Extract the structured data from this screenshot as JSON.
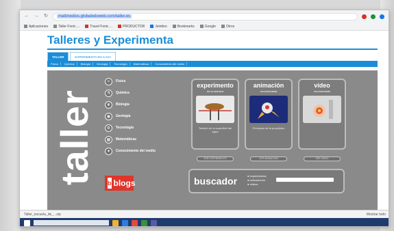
{
  "browser": {
    "url": "mattmedios.globaleduweb.com/taller.es",
    "bookmarks": [
      "Aplicaciones",
      "Taller Fonic ...",
      "Travel Fonic ...",
      "PRODUCTOR",
      "Jointtoo",
      "Bookmarks",
      "Google",
      "Otros"
    ]
  },
  "site": {
    "title": "Talleres y Experimenta",
    "tabs": [
      {
        "label": "TALLER"
      },
      {
        "label": "EXPERIMENTA EN CASA"
      }
    ],
    "subnav": [
      "Física",
      "Química",
      "Biología",
      "Geología",
      "Tecnología",
      "Matemáticas",
      "Conocimiento del medio"
    ]
  },
  "taller": {
    "heading": "taller",
    "sidebar": [
      {
        "label": "Física",
        "icon": "atom-icon"
      },
      {
        "label": "Química",
        "icon": "flask-icon"
      },
      {
        "label": "Biología",
        "icon": "leaf-icon"
      },
      {
        "label": "Geología",
        "icon": "globe-icon"
      },
      {
        "label": "Tecnología",
        "icon": "gear-icon"
      },
      {
        "label": "Matemáticas",
        "icon": "calculator-icon"
      },
      {
        "label": "Conocimiento del medio",
        "icon": "compass-icon"
      }
    ],
    "blogs_label": "blogs"
  },
  "cards": [
    {
      "title": "experimento",
      "title2": "de la semana",
      "caption": "Tensión en la superficie del agua",
      "button": "VER EXPERIMENTO"
    },
    {
      "title": "animación",
      "title2": "recomendada",
      "caption": "Principios de la propulsión",
      "button": "VER ANIMACIÓN"
    },
    {
      "title": "vídeo",
      "title2": "recomendado",
      "caption": "",
      "button": "VER VÍDEO"
    }
  ],
  "search": {
    "label": "buscador",
    "options": [
      "● experimentos",
      "● animaciones",
      "● vídeos"
    ]
  },
  "status": {
    "download": "Taller_escuela_de_...zip",
    "right": "Mostrar todo"
  },
  "colors": {
    "accent": "#1a8dd8",
    "taller_bg": "#8a8a8a",
    "blogs": "#e0352b"
  }
}
